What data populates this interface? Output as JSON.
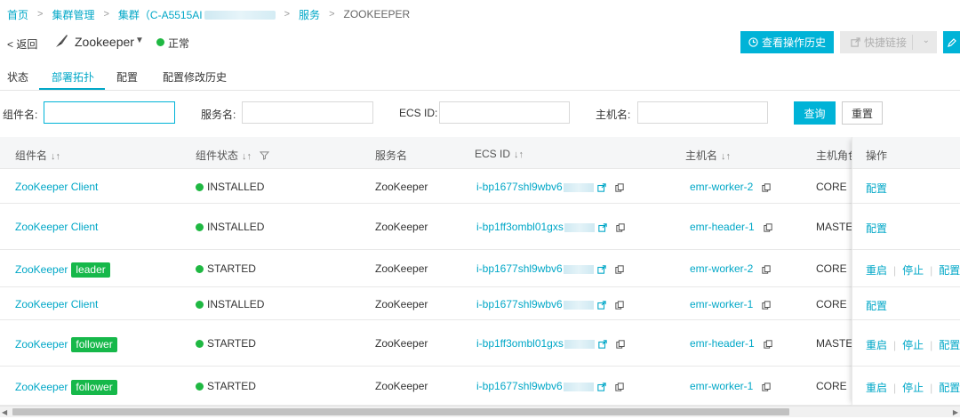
{
  "breadcrumb": {
    "home": "首页",
    "cluster_mgmt": "集群管理",
    "cluster": "集群（C-A5515AI",
    "service": "服务",
    "current": "ZOOKEEPER"
  },
  "header": {
    "back_label": "< 返回",
    "app_name": "Zookeeper",
    "status_text": "正常",
    "history_button": "查看操作历史",
    "quick_link_button": "快捷链接"
  },
  "tabs": [
    {
      "label": "状态"
    },
    {
      "label": "部署拓扑"
    },
    {
      "label": "配置"
    },
    {
      "label": "配置修改历史"
    }
  ],
  "filters": {
    "component_label": "组件名:",
    "service_label": "服务名:",
    "ecs_label": "ECS ID:",
    "host_label": "主机名:",
    "component_value": "",
    "service_value": "",
    "ecs_value": "",
    "host_value": "",
    "query_button": "查询",
    "reset_button": "重置"
  },
  "table": {
    "headers": {
      "component": "组件名",
      "status": "组件状态",
      "service": "服务名",
      "ecs": "ECS ID",
      "host": "主机名",
      "role": "主机角色",
      "ops": "操作"
    },
    "rows": [
      {
        "component": "ZooKeeper Client",
        "tag": "",
        "status": "INSTALLED",
        "service": "ZooKeeper",
        "ecs": "i-bp1677shl9wbv6",
        "host": "emr-worker-2",
        "role": "CORE",
        "ops": [
          "配置"
        ]
      },
      {
        "component": "ZooKeeper Client",
        "tag": "",
        "status": "INSTALLED",
        "service": "ZooKeeper",
        "ecs": "i-bp1ff3ombl01gxs",
        "host": "emr-header-1",
        "role": "MASTER",
        "ops": [
          "配置"
        ]
      },
      {
        "component": "ZooKeeper",
        "tag": "leader",
        "status": "STARTED",
        "service": "ZooKeeper",
        "ecs": "i-bp1677shl9wbv6",
        "host": "emr-worker-2",
        "role": "CORE",
        "ops": [
          "重启",
          "停止",
          "配置"
        ]
      },
      {
        "component": "ZooKeeper Client",
        "tag": "",
        "status": "INSTALLED",
        "service": "ZooKeeper",
        "ecs": "i-bp1677shl9wbv6",
        "host": "emr-worker-1",
        "role": "CORE",
        "ops": [
          "配置"
        ]
      },
      {
        "component": "ZooKeeper",
        "tag": "follower",
        "status": "STARTED",
        "service": "ZooKeeper",
        "ecs": "i-bp1ff3ombl01gxs",
        "host": "emr-header-1",
        "role": "MASTER",
        "ops": [
          "重启",
          "停止",
          "配置"
        ]
      },
      {
        "component": "ZooKeeper",
        "tag": "follower",
        "status": "STARTED",
        "service": "ZooKeeper",
        "ecs": "i-bp1677shl9wbv6",
        "host": "emr-worker-1",
        "role": "CORE",
        "ops": [
          "重启",
          "停止",
          "配置"
        ]
      }
    ]
  },
  "colors": {
    "accent": "#00b3d7",
    "link": "#00a7c7",
    "status_green": "#1fb842",
    "tag_green": "#16b84a"
  }
}
